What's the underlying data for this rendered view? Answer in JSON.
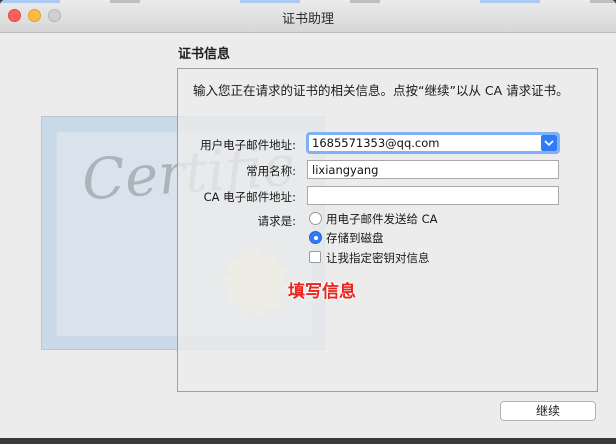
{
  "window": {
    "title": "证书助理"
  },
  "section": {
    "title": "证书信息"
  },
  "intro_text": "输入您正在请求的证书的相关信息。点按“继续”以从 CA 请求证书。",
  "form": {
    "email_label": "用户电子邮件地址:",
    "email_value": "1685571353@qq.com",
    "name_label": "常用名称:",
    "name_value": "lixiangyang",
    "ca_email_label": "CA 电子邮件地址:",
    "ca_email_value": "",
    "request_label": "请求是:",
    "options": [
      {
        "label": "用电子邮件发送给 CA",
        "selected": false
      },
      {
        "label": "存储到磁盘",
        "selected": true
      }
    ],
    "checkbox_label": "让我指定密钥对信息",
    "checkbox_checked": false
  },
  "certificate_watermark": "Certific",
  "annotation": "填写信息",
  "buttons": {
    "continue": "继续"
  },
  "colors": {
    "accent": "#2f7cf6",
    "annotation": "#e8241c",
    "close": "#fc605b",
    "minimize": "#fdbc40"
  }
}
